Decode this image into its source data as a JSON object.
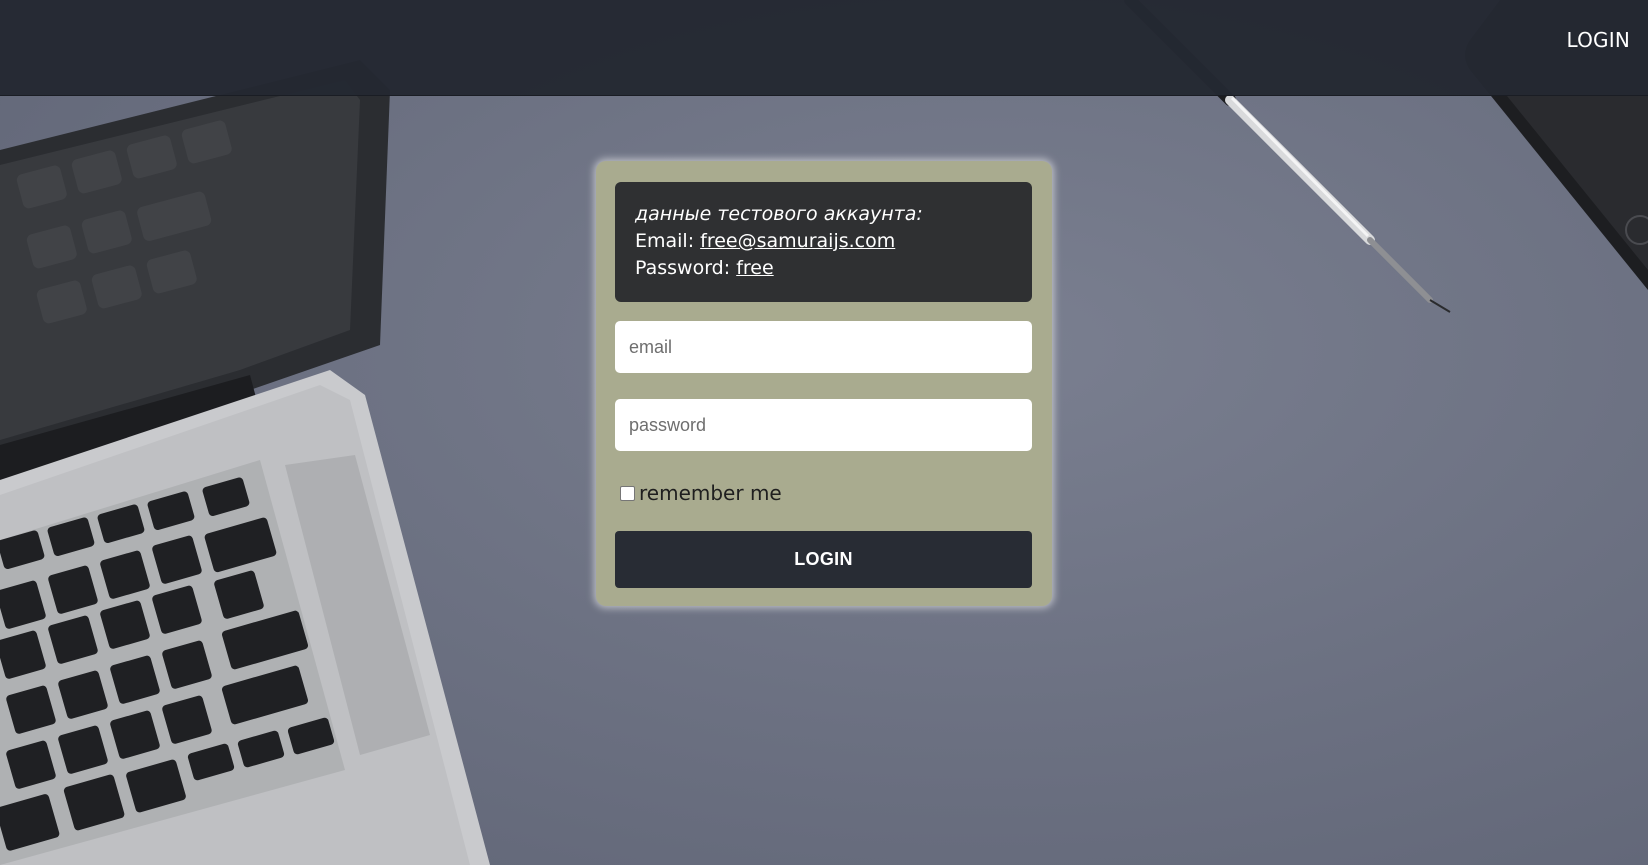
{
  "header": {
    "login_label": "LOGIN"
  },
  "info_box": {
    "heading": "данные тестового аккаунта:",
    "email_label": "Email: ",
    "email_value": "free@samuraijs.com",
    "password_label": "Password: ",
    "password_value": "free"
  },
  "form": {
    "email_placeholder": "email",
    "password_placeholder": "password",
    "remember_label": "remember me",
    "remember_checked": false,
    "submit_label": "LOGIN"
  },
  "colors": {
    "header_bg": "#242832",
    "card_bg": "#a9ab8f",
    "info_bg": "#2f3032",
    "button_bg": "#282c34",
    "page_bg": "#6b7080"
  },
  "icons": [
    "laptop-image",
    "pen-image",
    "tablet-image"
  ]
}
